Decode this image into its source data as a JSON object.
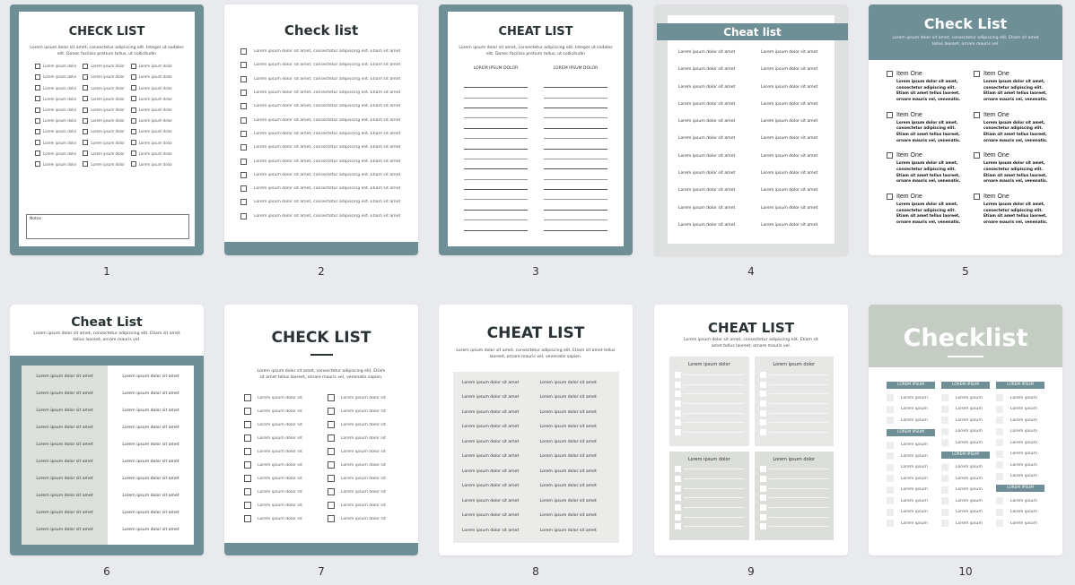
{
  "pages": [
    {
      "number": "1",
      "title": "CHECK LIST",
      "intro": "Lorem ipsum dolor sit amet, consectetur adipiscing elit. Integer ut sodales elit. Donec facilisis pretium tellus, ut sollicitudin",
      "item_label": "Lorem ipsum dolor",
      "columns": 3,
      "rows": 10,
      "notes_label": "Notes",
      "accent": "#6e8f96"
    },
    {
      "number": "2",
      "title": "Check list",
      "item_label": "Lorem ipsum dolor sit amet, consectetur adipiscing elit. Etiam sit amet",
      "rows": 13,
      "accent": "#6e8f96"
    },
    {
      "number": "3",
      "title": "CHEAT LIST",
      "intro": "Lorem ipsum dolor sit amet, consectetur adipiscing elit. Integer ut sodales elit. Donec facilisis pretium tellus, ut sollicitudin",
      "column_headers": [
        "LOREM IPSUM DOLOR",
        "LOREM IPSUM DOLOR"
      ],
      "lines": 15,
      "accent": "#6e8f96"
    },
    {
      "number": "4",
      "title": "Cheat list",
      "item_label": "Lorem ipsum dolor sit amet",
      "columns": 2,
      "rows": 11,
      "accent": "#6e8f96"
    },
    {
      "number": "5",
      "title": "Check List",
      "intro": "Lorem ipsum dolor sit amet, consectetur adipiscing elit. Etiam sit amet tellus laoreet, ornare mauris vel.",
      "item_heading": "Item One",
      "item_body": "Lorem ipsum dolor sit amet, consectetur adipiscing elit. Etiam sit amet tellus laoreet, ornare mauris vel, venenatis.",
      "count": 8,
      "accent": "#6e8f96"
    },
    {
      "number": "6",
      "title": "Cheat List",
      "intro": "Lorem ipsum dolor sit amet, consectetur adipiscing elit. Etiam sit amet tellus laoreet, ornare mauris vel.",
      "item_label": "Lorem ipsum dolor sit amet",
      "rows": 10,
      "accent": "#6e8f96"
    },
    {
      "number": "7",
      "title": "CHECK LIST",
      "intro": "Lorem ipsum dolor sit amet, consectetur adipiscing elit. Etiam sit amet tellus laoreet, ornare mauris vel, venenatis sapien.",
      "item_label": "Lorem ipsum dolor sit",
      "rows": 10,
      "accent": "#6e8f96"
    },
    {
      "number": "8",
      "title": "CHEAT LIST",
      "intro": "Lorem ipsum dolor sit amet, consectetur adipiscing elit. Etiam sit amet tellus laoreet, ornare mauris vel, venenatis sapien.",
      "item_label": "Lorem ipsum dolor sit amet",
      "rows": 11
    },
    {
      "number": "9",
      "title": "CHEAT LIST",
      "intro": "Lorem ipsum dolor sit amet, consectetur adipiscing elit. Etiam sit amet tellus laoreet, ornare mauris vel.",
      "box_heading": "Lorem ipsum dolor",
      "boxes": 4,
      "lines_per_box": 7
    },
    {
      "number": "10",
      "title": "Checklist",
      "section_label": "LOREM IPSUM",
      "item_label": "Lorem ipsum",
      "columns": [
        [
          {
            "section": true
          },
          3,
          {
            "section": true
          },
          8
        ],
        [
          {
            "section": true
          },
          5,
          {
            "section": true
          },
          6
        ],
        [
          {
            "section": true
          },
          8,
          {
            "section": true
          },
          3
        ]
      ],
      "header_color": "#c5ccc4",
      "accent": "#6e8f96"
    }
  ]
}
